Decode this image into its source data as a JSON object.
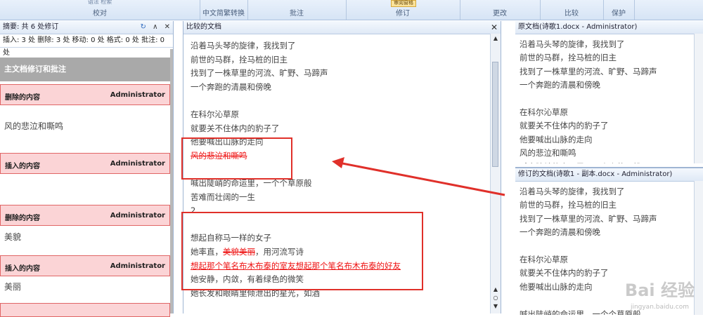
{
  "ribbon": {
    "groups": [
      {
        "label": "校对",
        "top": "语法  检索"
      },
      {
        "label": "中文简繁转换",
        "top": ""
      },
      {
        "label": "批注",
        "top": ""
      },
      {
        "label": "修订",
        "top": ""
      },
      {
        "label": "更改",
        "top": ""
      },
      {
        "label": "比较",
        "top": ""
      },
      {
        "label": "保护",
        "top": ""
      }
    ],
    "highlight_text": "审阅窗格"
  },
  "summary_pane": {
    "header": "摘要: 共 6 处修订",
    "stats": "插入: 3 处  删除: 3 处  移动: 0 处  格式: 0 处  批注: 0 处",
    "main_title": "主文档修订和批注",
    "revisions": [
      {
        "type": "删除的内容",
        "author": "Administrator",
        "text": "风的悲泣和嘶鸣"
      },
      {
        "type": "插入的内容",
        "author": "Administrator",
        "text": ""
      },
      {
        "type": "删除的内容",
        "author": "Administrator",
        "text": "美貌"
      },
      {
        "type": "插入的内容",
        "author": "Administrator",
        "text": "美丽"
      }
    ]
  },
  "compare_pane": {
    "header": "比较的文档",
    "lines": [
      {
        "t": "沿着马头琴的旋律，我找到了"
      },
      {
        "t": "前世的马群，拴马桩的旧主"
      },
      {
        "t": "找到了一株草里的河流、旷野、马蹄声"
      },
      {
        "t": "一个奔跑的清晨和傍晚"
      },
      {
        "t": ""
      },
      {
        "t": "在科尔沁草原"
      },
      {
        "t": "就要关不住体内的豹子了"
      },
      {
        "t": "他要喊出山脉的走向"
      },
      {
        "t": "风的悲泣和嘶鸣",
        "style": "del"
      },
      {
        "t": ""
      },
      {
        "t": "喊出陡峭的命运里，一个个草原般"
      },
      {
        "t": "苦难而壮阔的一生"
      },
      {
        "t": "2."
      },
      {
        "t": ""
      },
      {
        "t": "想起自称马一样的女子"
      },
      {
        "t": "她率直，",
        "del": "美貌美丽",
        "tail": "，用河流写诗"
      },
      {
        "t": "想起那个笔名布木布泰的室友想起那个笔名布木布泰的好友",
        "style": "ins"
      },
      {
        "t": "她安静，内敛，有着绿色的微笑"
      },
      {
        "t": "她长发和眼睛里倾泄出的星光，如酒"
      }
    ]
  },
  "original_pane": {
    "header": "原文档(诗歌1.docx - Administrator)",
    "lines": [
      "沿着马头琴的旋律，我找到了",
      "前世的马群，拴马桩的旧主",
      "找到了一株草里的河流、旷野、马蹄声",
      "一个奔跑的清晨和傍晚",
      "",
      "在科尔沁草原",
      "就要关不住体内的豹子了",
      "他要喊出山脉的走向",
      "风的悲泣和嘶鸣",
      "喊出陡峭的命运里，一个个草原般"
    ]
  },
  "revised_pane": {
    "header": "修订的文档(诗歌1 - 副本.docx - Administrator)",
    "lines": [
      "沿着马头琴的旋律，我找到了",
      "前世的马群，拴马桩的旧主",
      "找到了一株草里的河流、旷野、马蹄声",
      "一个奔跑的清晨和傍晚",
      "",
      "在科尔沁草原",
      "就要关不住体内的豹子了",
      "他要喊出山脉的走向",
      "",
      "喊出陡峭的命运里，一个个草原般"
    ]
  },
  "watermark": {
    "main": "Bai 经验",
    "sub": "jingyan.baidu.com"
  },
  "colors": {
    "accent_red": "#e0302a",
    "deleted_fill": "#fbd4d6",
    "main_title_fill": "#a9a9a9"
  }
}
